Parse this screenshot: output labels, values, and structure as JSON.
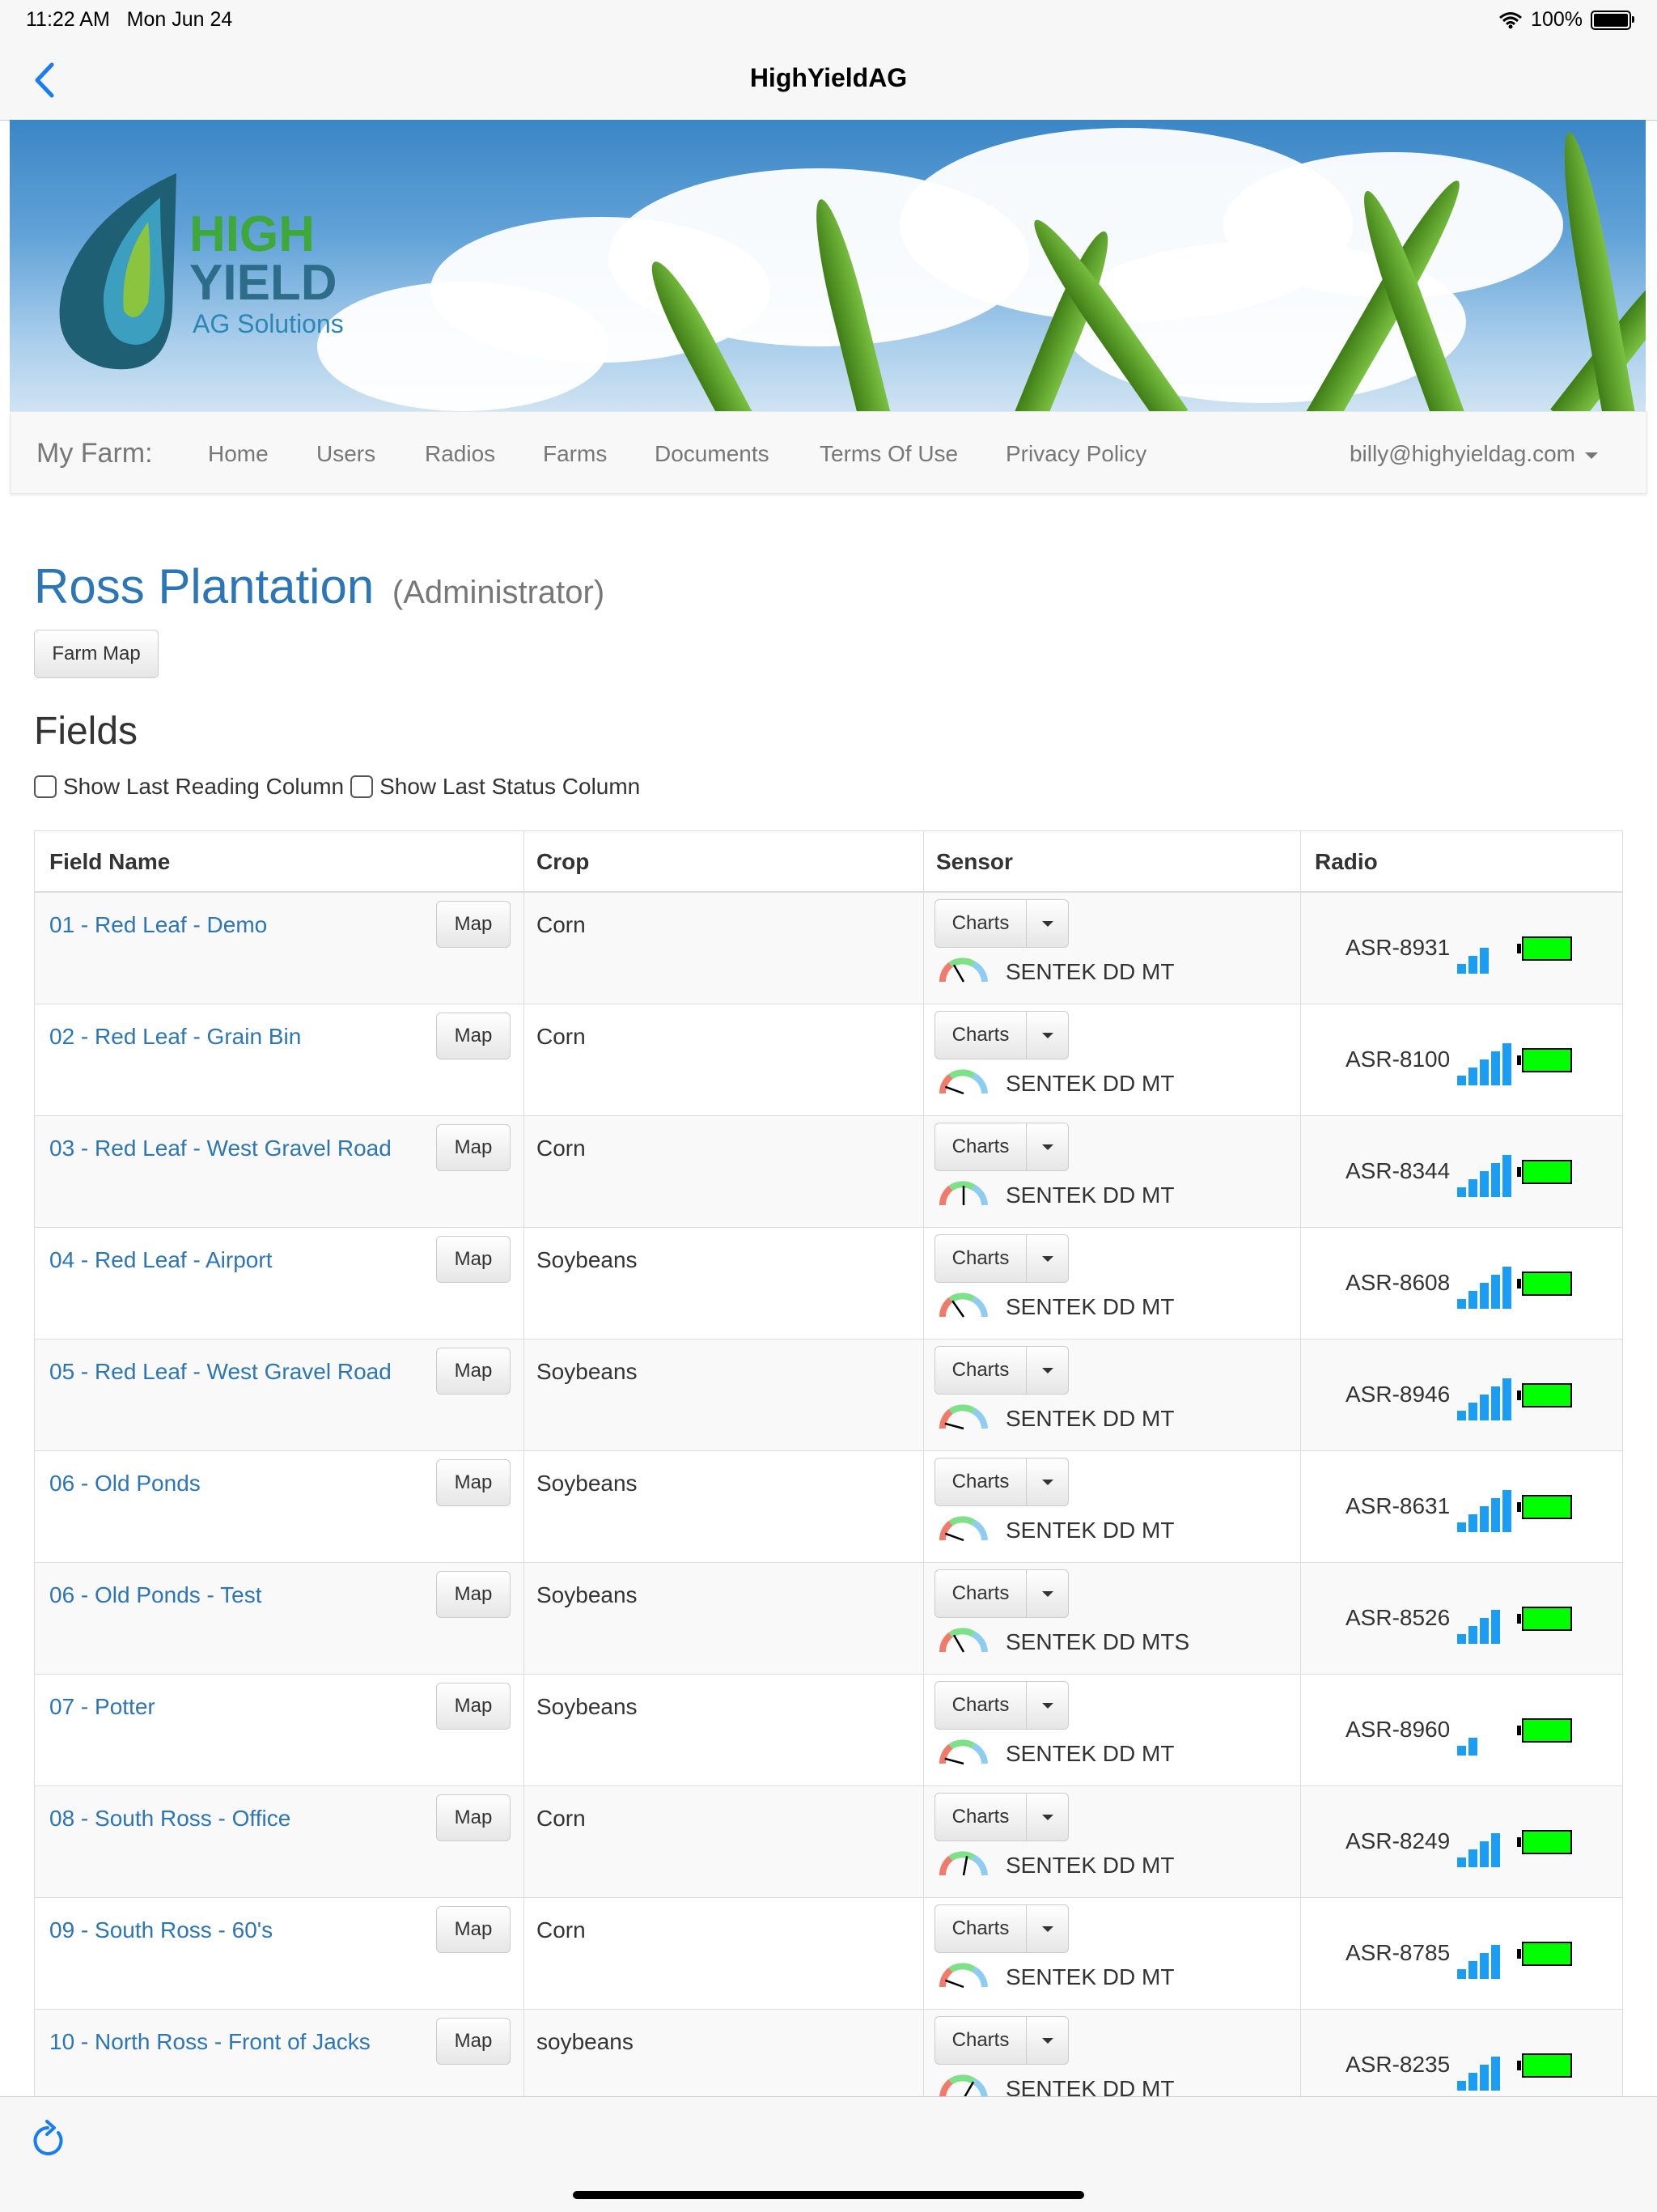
{
  "status": {
    "time": "11:22 AM",
    "date": "Mon Jun 24",
    "battery": "100%"
  },
  "nav": {
    "title": "HighYieldAG"
  },
  "logo": {
    "high": "HIGH",
    "yield": "YIELD",
    "sub": "AG Solutions"
  },
  "menu": {
    "brand": "My Farm:",
    "items": [
      "Home",
      "Users",
      "Radios",
      "Farms",
      "Documents",
      "Terms Of Use",
      "Privacy Policy"
    ],
    "user": "billy@highyieldag.com"
  },
  "farm": {
    "name": "Ross Plantation",
    "role": "(Administrator)",
    "map_button": "Farm Map"
  },
  "fields": {
    "title": "Fields",
    "show_last_reading": "Show Last Reading Column",
    "show_last_status": "Show Last Status Column",
    "headers": [
      "Field Name",
      "Crop",
      "Sensor",
      "Radio"
    ],
    "map_label": "Map",
    "charts_label": "Charts",
    "rows": [
      {
        "name": "01 - Red Leaf - Demo",
        "crop": "Corn",
        "sensor": "SENTEK DD MT",
        "radio": "ASR-8931",
        "signal": 3
      },
      {
        "name": "02 - Red Leaf - Grain Bin",
        "crop": "Corn",
        "sensor": "SENTEK DD MT",
        "radio": "ASR-8100",
        "signal": 5
      },
      {
        "name": "03 - Red Leaf - West Gravel Road",
        "crop": "Corn",
        "sensor": "SENTEK DD MT",
        "radio": "ASR-8344",
        "signal": 5
      },
      {
        "name": "04 - Red Leaf - Airport",
        "crop": "Soybeans",
        "sensor": "SENTEK DD MT",
        "radio": "ASR-8608",
        "signal": 5
      },
      {
        "name": "05 - Red Leaf - West Gravel Road",
        "crop": "Soybeans",
        "sensor": "SENTEK DD MT",
        "radio": "ASR-8946",
        "signal": 5
      },
      {
        "name": "06 - Old Ponds",
        "crop": "Soybeans",
        "sensor": "SENTEK DD MT",
        "radio": "ASR-8631",
        "signal": 5
      },
      {
        "name": "06 - Old Ponds - Test",
        "crop": "Soybeans",
        "sensor": "SENTEK DD MTS",
        "radio": "ASR-8526",
        "signal": 4
      },
      {
        "name": "07 - Potter",
        "crop": "Soybeans",
        "sensor": "SENTEK DD MT",
        "radio": "ASR-8960",
        "signal": 2
      },
      {
        "name": "08 - South Ross - Office",
        "crop": "Corn",
        "sensor": "SENTEK DD MT",
        "radio": "ASR-8249",
        "signal": 4
      },
      {
        "name": "09 - South Ross - 60's",
        "crop": "Corn",
        "sensor": "SENTEK DD MT",
        "radio": "ASR-8785",
        "signal": 4
      },
      {
        "name": "10 - North Ross - Front of Jacks",
        "crop": "soybeans",
        "sensor": "SENTEK DD MT",
        "radio": "ASR-8235",
        "signal": 4
      }
    ]
  },
  "colors": {
    "link": "#2c76b7",
    "battery": "#00ff00",
    "signal": "#1a9df2"
  }
}
